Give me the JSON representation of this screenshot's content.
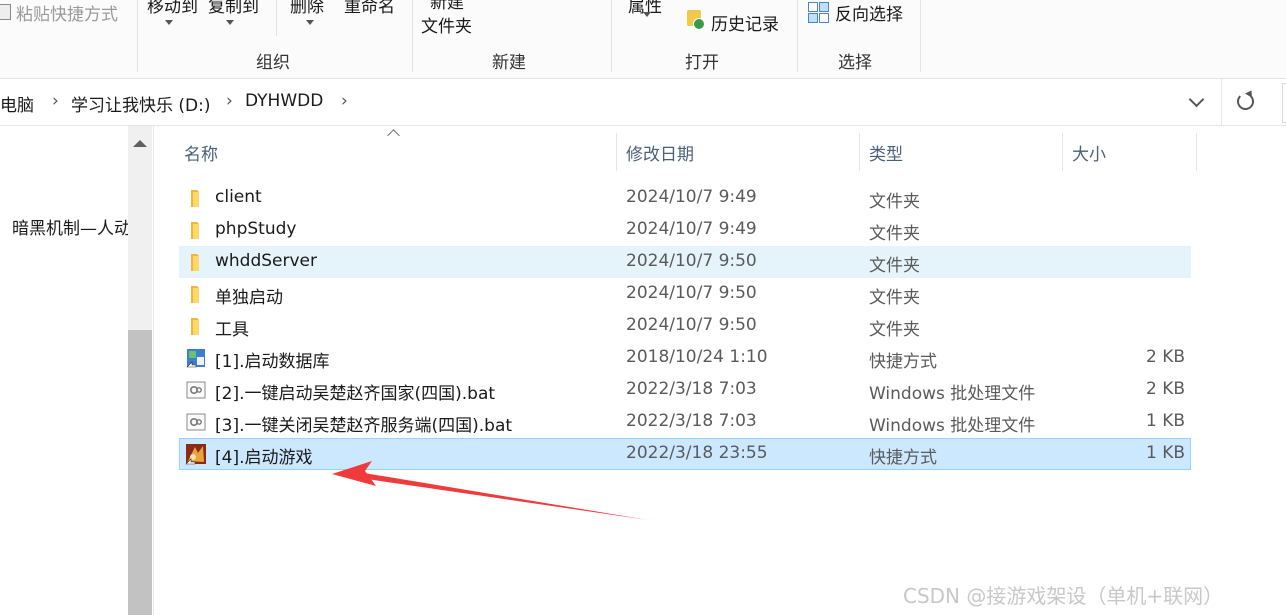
{
  "ribbon": {
    "paste_shortcut": "粘贴快捷方式",
    "move_to": "移动到",
    "copy_to": "复制到",
    "delete": "删除",
    "rename": "重命名",
    "new_label": "新建",
    "new_folder": "文件夹",
    "properties": "属性",
    "history": "历史记录",
    "invert_selection": "反向选择",
    "groups": {
      "organize": "组织",
      "new": "新建",
      "open": "打开",
      "select": "选择"
    }
  },
  "address": {
    "crumbs": [
      "此电脑",
      "学习让我快乐 (D:)",
      "DYHWDD"
    ]
  },
  "nav": {
    "item": "暗黑机制—人动"
  },
  "columns": {
    "name": "名称",
    "date": "修改日期",
    "type": "类型",
    "size": "大小"
  },
  "files": [
    {
      "name": "client",
      "date": "2024/10/7 9:49",
      "type": "文件夹",
      "size": "",
      "icon": "folder-icon"
    },
    {
      "name": "phpStudy",
      "date": "2024/10/7 9:49",
      "type": "文件夹",
      "size": "",
      "icon": "folder-icon"
    },
    {
      "name": "whddServer",
      "date": "2024/10/7 9:50",
      "type": "文件夹",
      "size": "",
      "icon": "folder-icon"
    },
    {
      "name": "单独启动",
      "date": "2024/10/7 9:50",
      "type": "文件夹",
      "size": "",
      "icon": "folder-icon"
    },
    {
      "name": "工具",
      "date": "2024/10/7 9:50",
      "type": "文件夹",
      "size": "",
      "icon": "folder-icon"
    },
    {
      "name": "[1].启动数据库",
      "date": "2018/10/24 1:10",
      "type": "快捷方式",
      "size": "2 KB",
      "icon": "shortcut-app-icon"
    },
    {
      "name": "[2].一键启动吴楚赵齐国家(四国).bat",
      "date": "2022/3/18 7:03",
      "type": "Windows 批处理文件",
      "size": "2 KB",
      "icon": "batch-file-icon"
    },
    {
      "name": "[3].一键关闭吴楚赵齐服务端(四国).bat",
      "date": "2022/3/18 7:03",
      "type": "Windows 批处理文件",
      "size": "1 KB",
      "icon": "batch-file-icon"
    },
    {
      "name": "[4].启动游戏",
      "date": "2022/3/18 23:55",
      "type": "快捷方式",
      "size": "1 KB",
      "icon": "game-shortcut-icon"
    }
  ],
  "watermark": "CSDN @接游戏架设（单机+联网）",
  "colors": {
    "accent_arrow": "#ef3b3b",
    "selected_row": "#cce8ff",
    "hover_row": "#e5f3fb"
  }
}
